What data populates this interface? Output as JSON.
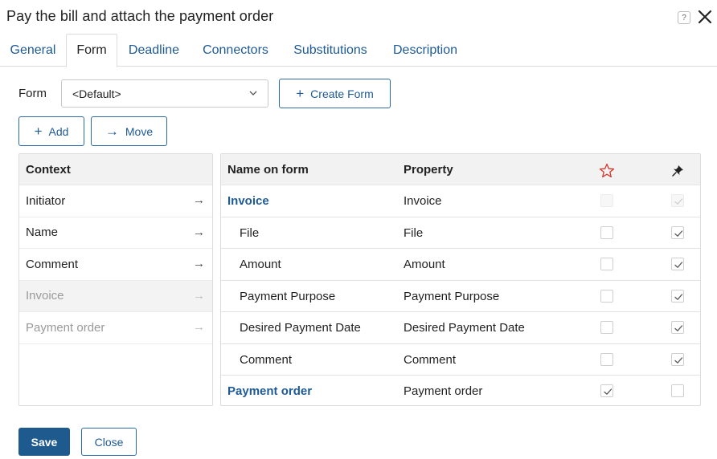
{
  "window": {
    "title": "Pay the bill and attach the payment order",
    "help_label": "?"
  },
  "tabs": [
    {
      "label": "General"
    },
    {
      "label": "Form",
      "active": true
    },
    {
      "label": "Deadline"
    },
    {
      "label": "Connectors"
    },
    {
      "label": "Substitutions"
    },
    {
      "label": "Description"
    }
  ],
  "form_select": {
    "label": "Form",
    "value": "<Default>"
  },
  "toolbar": {
    "create_form_label": "Create Form",
    "add_label": "Add",
    "move_label": "Move",
    "plus_glyph": "+",
    "arrow_glyph": "→"
  },
  "context": {
    "header": "Context",
    "items": [
      {
        "label": "Initiator",
        "state": "normal"
      },
      {
        "label": "Name",
        "state": "normal"
      },
      {
        "label": "Comment",
        "state": "normal"
      },
      {
        "label": "Invoice",
        "state": "disabled-selected"
      },
      {
        "label": "Payment order",
        "state": "disabled"
      }
    ]
  },
  "fields_table": {
    "headers": {
      "name": "Name on form",
      "property": "Property",
      "required_icon": "star-icon",
      "readonly_icon": "pin-icon"
    },
    "rows": [
      {
        "name": "Invoice",
        "property": "Invoice",
        "group": true,
        "required": false,
        "readonly": true,
        "muted": true
      },
      {
        "name": "File",
        "property": "File",
        "group": false,
        "required": false,
        "readonly": true,
        "muted": false
      },
      {
        "name": "Amount",
        "property": "Amount",
        "group": false,
        "required": false,
        "readonly": true,
        "muted": false
      },
      {
        "name": "Payment Purpose",
        "property": "Payment Purpose",
        "group": false,
        "required": false,
        "readonly": true,
        "muted": false
      },
      {
        "name": "Desired Payment Date",
        "property": "Desired Payment Date",
        "group": false,
        "required": false,
        "readonly": true,
        "muted": false
      },
      {
        "name": "Comment",
        "property": "Comment",
        "group": false,
        "required": false,
        "readonly": true,
        "muted": false
      },
      {
        "name": "Payment order",
        "property": "Payment order",
        "group": true,
        "required": true,
        "readonly": false,
        "muted": false
      }
    ]
  },
  "footer": {
    "save_label": "Save",
    "close_label": "Close"
  },
  "colors": {
    "accent": "#1e5a96",
    "primary_button": "#1f5a8f",
    "star": "#d9342b"
  }
}
